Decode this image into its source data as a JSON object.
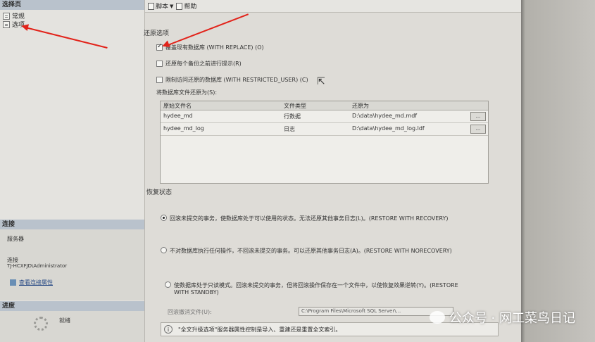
{
  "left": {
    "select_page_header": "选择页",
    "pages": [
      "常规",
      "选项"
    ],
    "connection_header": "连接",
    "server_label": "服务器",
    "connection_label": "连接",
    "connection_value": "TJ-HCXFJD\\Administrator",
    "view_conn_props": "查看连接属性",
    "progress_header": "进度",
    "progress_status": "就绪"
  },
  "toolbar": {
    "script_label": "脚本",
    "help_label": "帮助"
  },
  "restore_options": {
    "title": "还原选项",
    "opt_overwrite": "覆盖现有数据库 (WITH REPLACE) (O)",
    "opt_prompt": "还原每个备份之前进行提示(R)",
    "opt_restricted": "限制访问还原的数据库 (WITH RESTRICTED_USER) (C)",
    "checked": [
      true,
      false,
      false
    ]
  },
  "files": {
    "label": "将数据库文件还原为(S):",
    "columns": [
      "原始文件名",
      "文件类型",
      "还原为"
    ],
    "rows": [
      [
        "hydee_md",
        "行数据",
        "D:\\data\\hydee_md.mdf"
      ],
      [
        "hydee_md_log",
        "日志",
        "D:\\data\\hydee_md_log.ldf"
      ]
    ],
    "browse_label": "..."
  },
  "recovery": {
    "title": "恢复状态",
    "opt1": "回滚未提交的事务，使数据库处于可以使用的状态。无法还原其他事务日志(L)。(RESTORE WITH RECOVERY)",
    "opt2": "不对数据库执行任何操作，不回滚未提交的事务。可以还原其他事务日志(A)。(RESTORE WITH NORECOVERY)",
    "opt3": "使数据库处于只读模式。回滚未提交的事务，但将回滚操作保存在一个文件中，以使恢复效果逆转(Y)。(RESTORE WITH STANDBY)",
    "selected": 0,
    "rollback_file_label": "回滚撤消文件(U):",
    "rollback_file_value": "C:\\Program Files\\Microsoft SQL Server\\..."
  },
  "info_text": "\"全文升级选项\"服务器属性控制是导入、重建还是重置全文索引。",
  "watermark": "公众号 · 网工菜鸟日记"
}
